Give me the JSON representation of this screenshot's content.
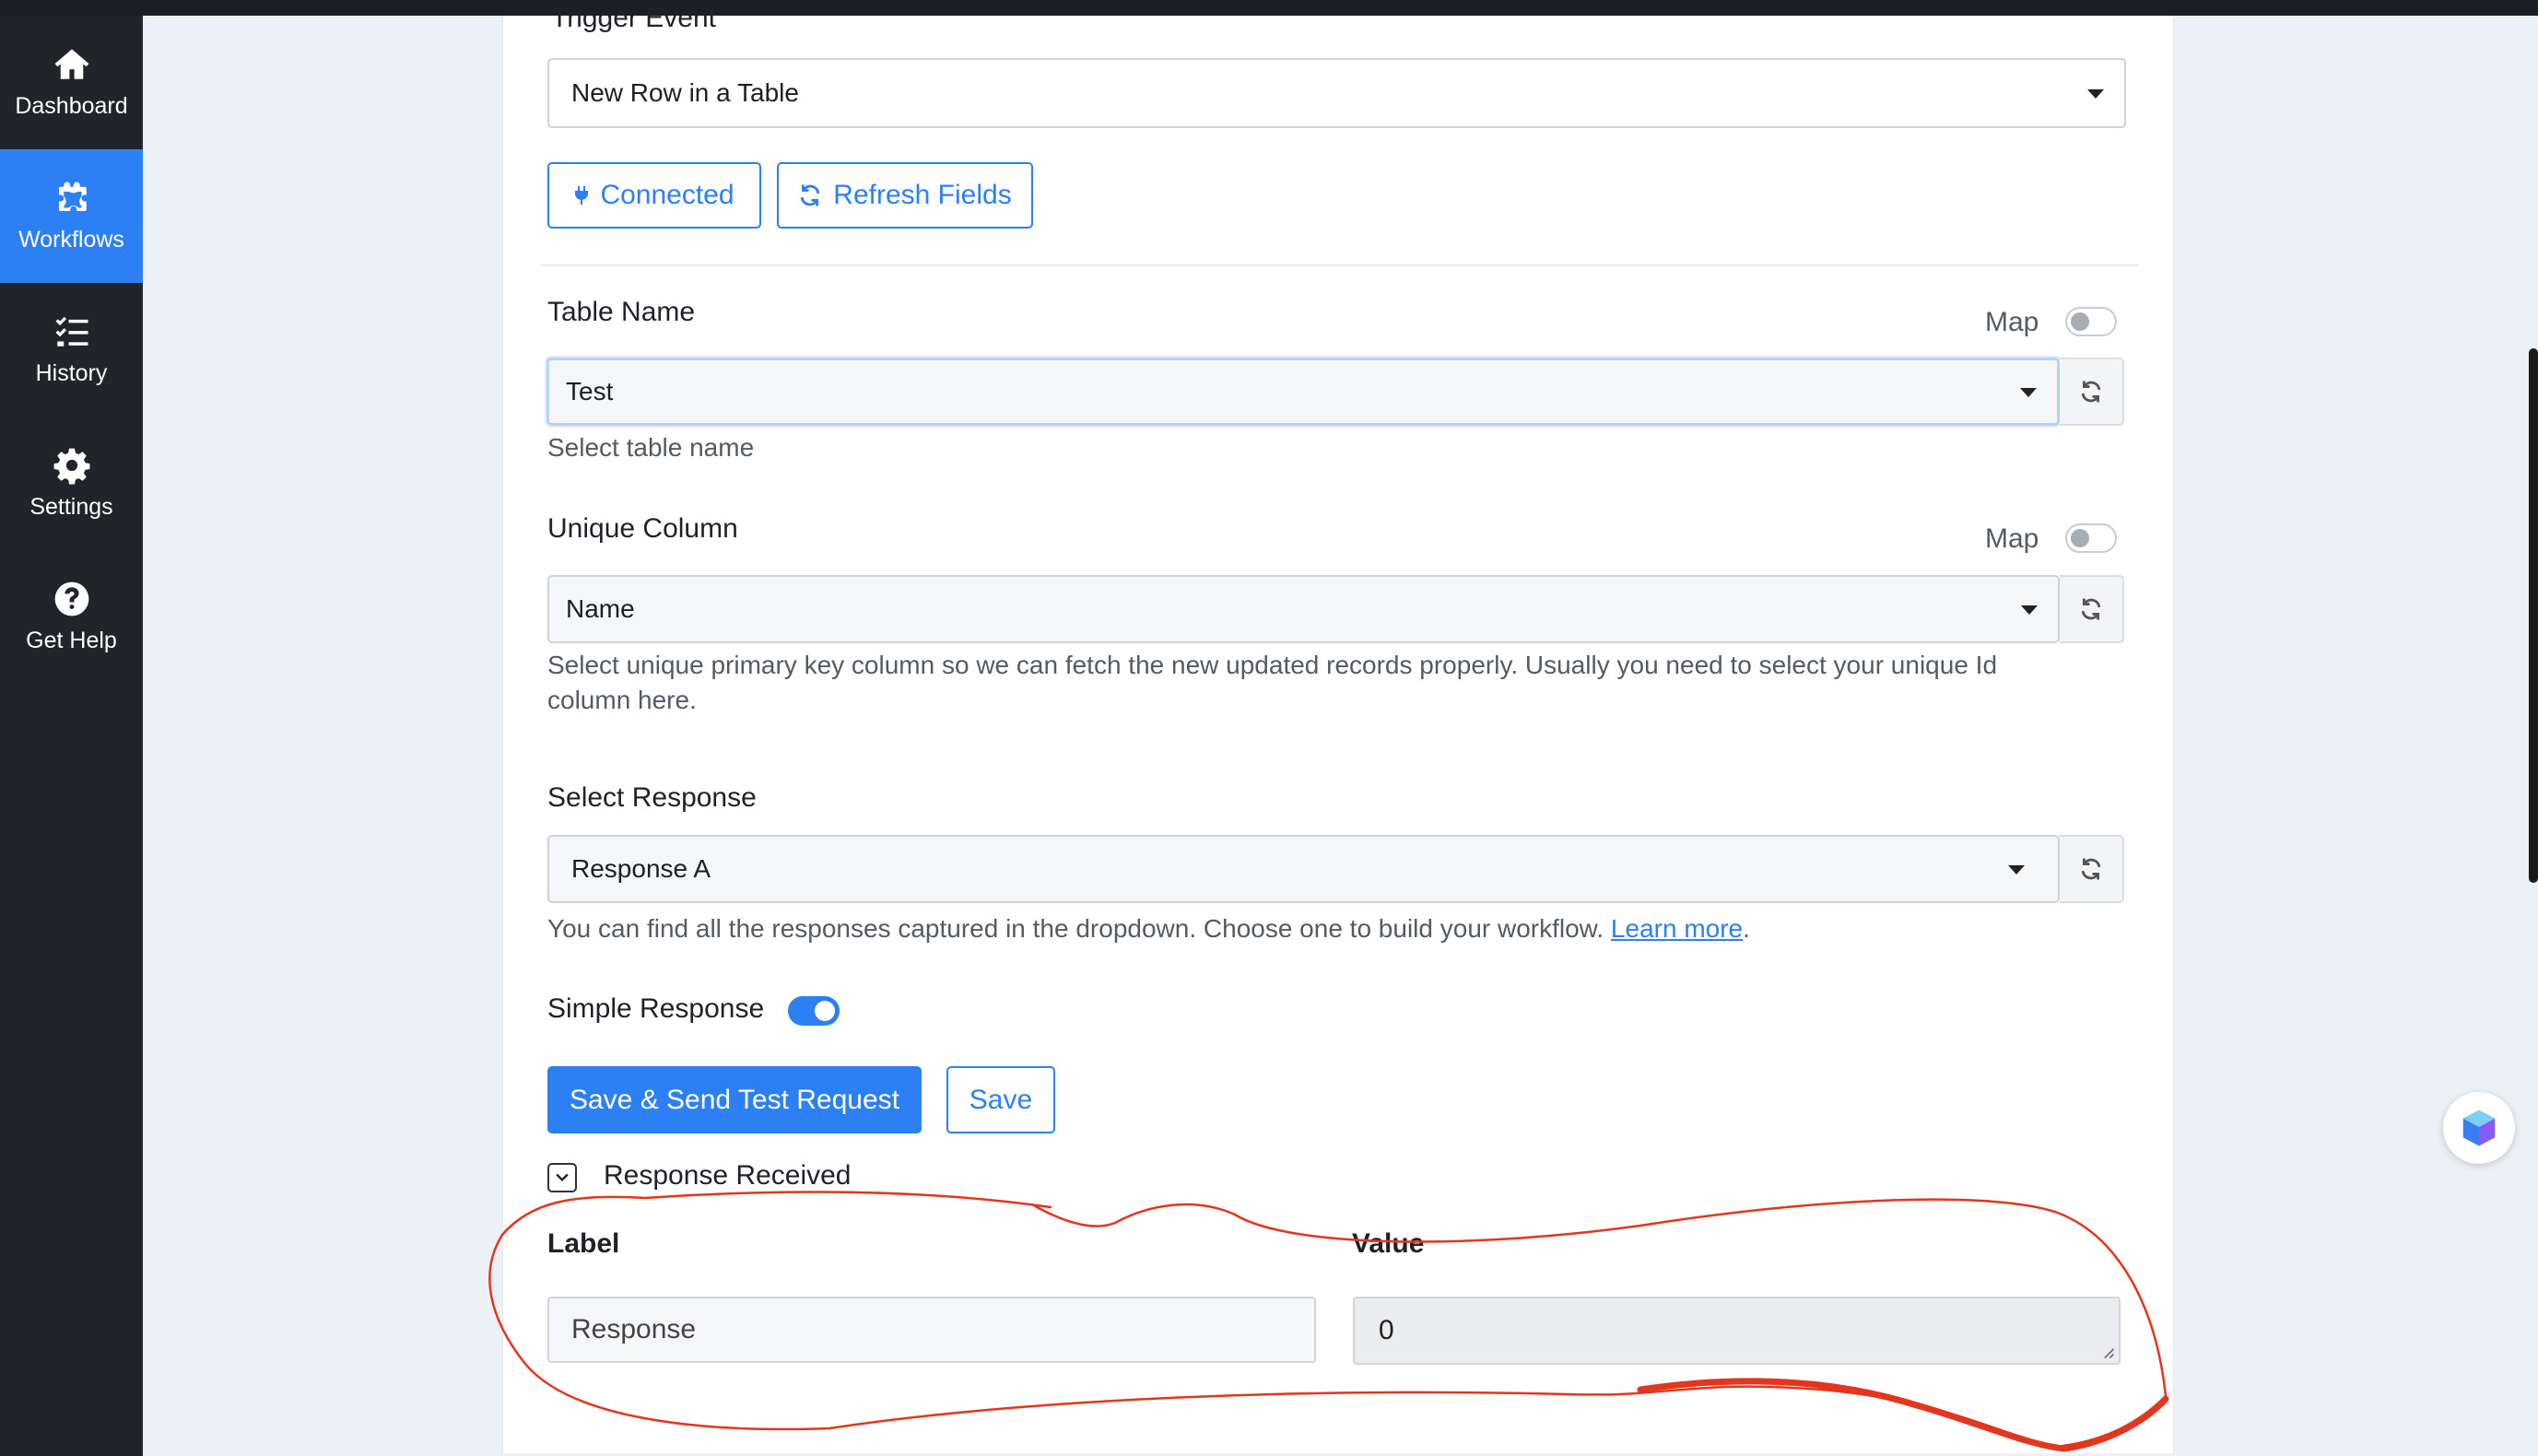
{
  "sidebar": {
    "items": [
      {
        "label": "Dashboard",
        "icon": "home-icon",
        "active": false
      },
      {
        "label": "Workflows",
        "icon": "puzzle-icon",
        "active": true
      },
      {
        "label": "History",
        "icon": "list-check-icon",
        "active": false
      },
      {
        "label": "Settings",
        "icon": "gear-icon",
        "active": false
      },
      {
        "label": "Get Help",
        "icon": "question-circle-icon",
        "active": false
      }
    ]
  },
  "trigger": {
    "label": "Trigger Event",
    "value": "New Row in a Table",
    "connected_label": "Connected",
    "refresh_label": "Refresh Fields"
  },
  "table_name": {
    "label": "Table Name",
    "map_label": "Map",
    "value": "Test",
    "help": "Select table name"
  },
  "unique_column": {
    "label": "Unique Column",
    "map_label": "Map",
    "value": "Name",
    "help": "Select unique primary key column so we can fetch the new updated records properly. Usually you need to select your unique Id column here."
  },
  "select_response": {
    "label": "Select Response",
    "value": "Response A",
    "help": "You can find all the responses captured in the dropdown. Choose one to build your workflow.",
    "link": "Learn more",
    "help_suffix": "."
  },
  "simple_response": {
    "label": "Simple Response",
    "enabled": true
  },
  "actions": {
    "save_send_label": "Save & Send Test Request",
    "save_label": "Save"
  },
  "response_received": {
    "label": "Response Received",
    "col_label": "Label",
    "col_value": "Value",
    "row_label": "Response",
    "row_value": "0"
  },
  "colors": {
    "accent": "#2c80f4",
    "sidebar": "#212529",
    "annotation": "#e2361f"
  }
}
